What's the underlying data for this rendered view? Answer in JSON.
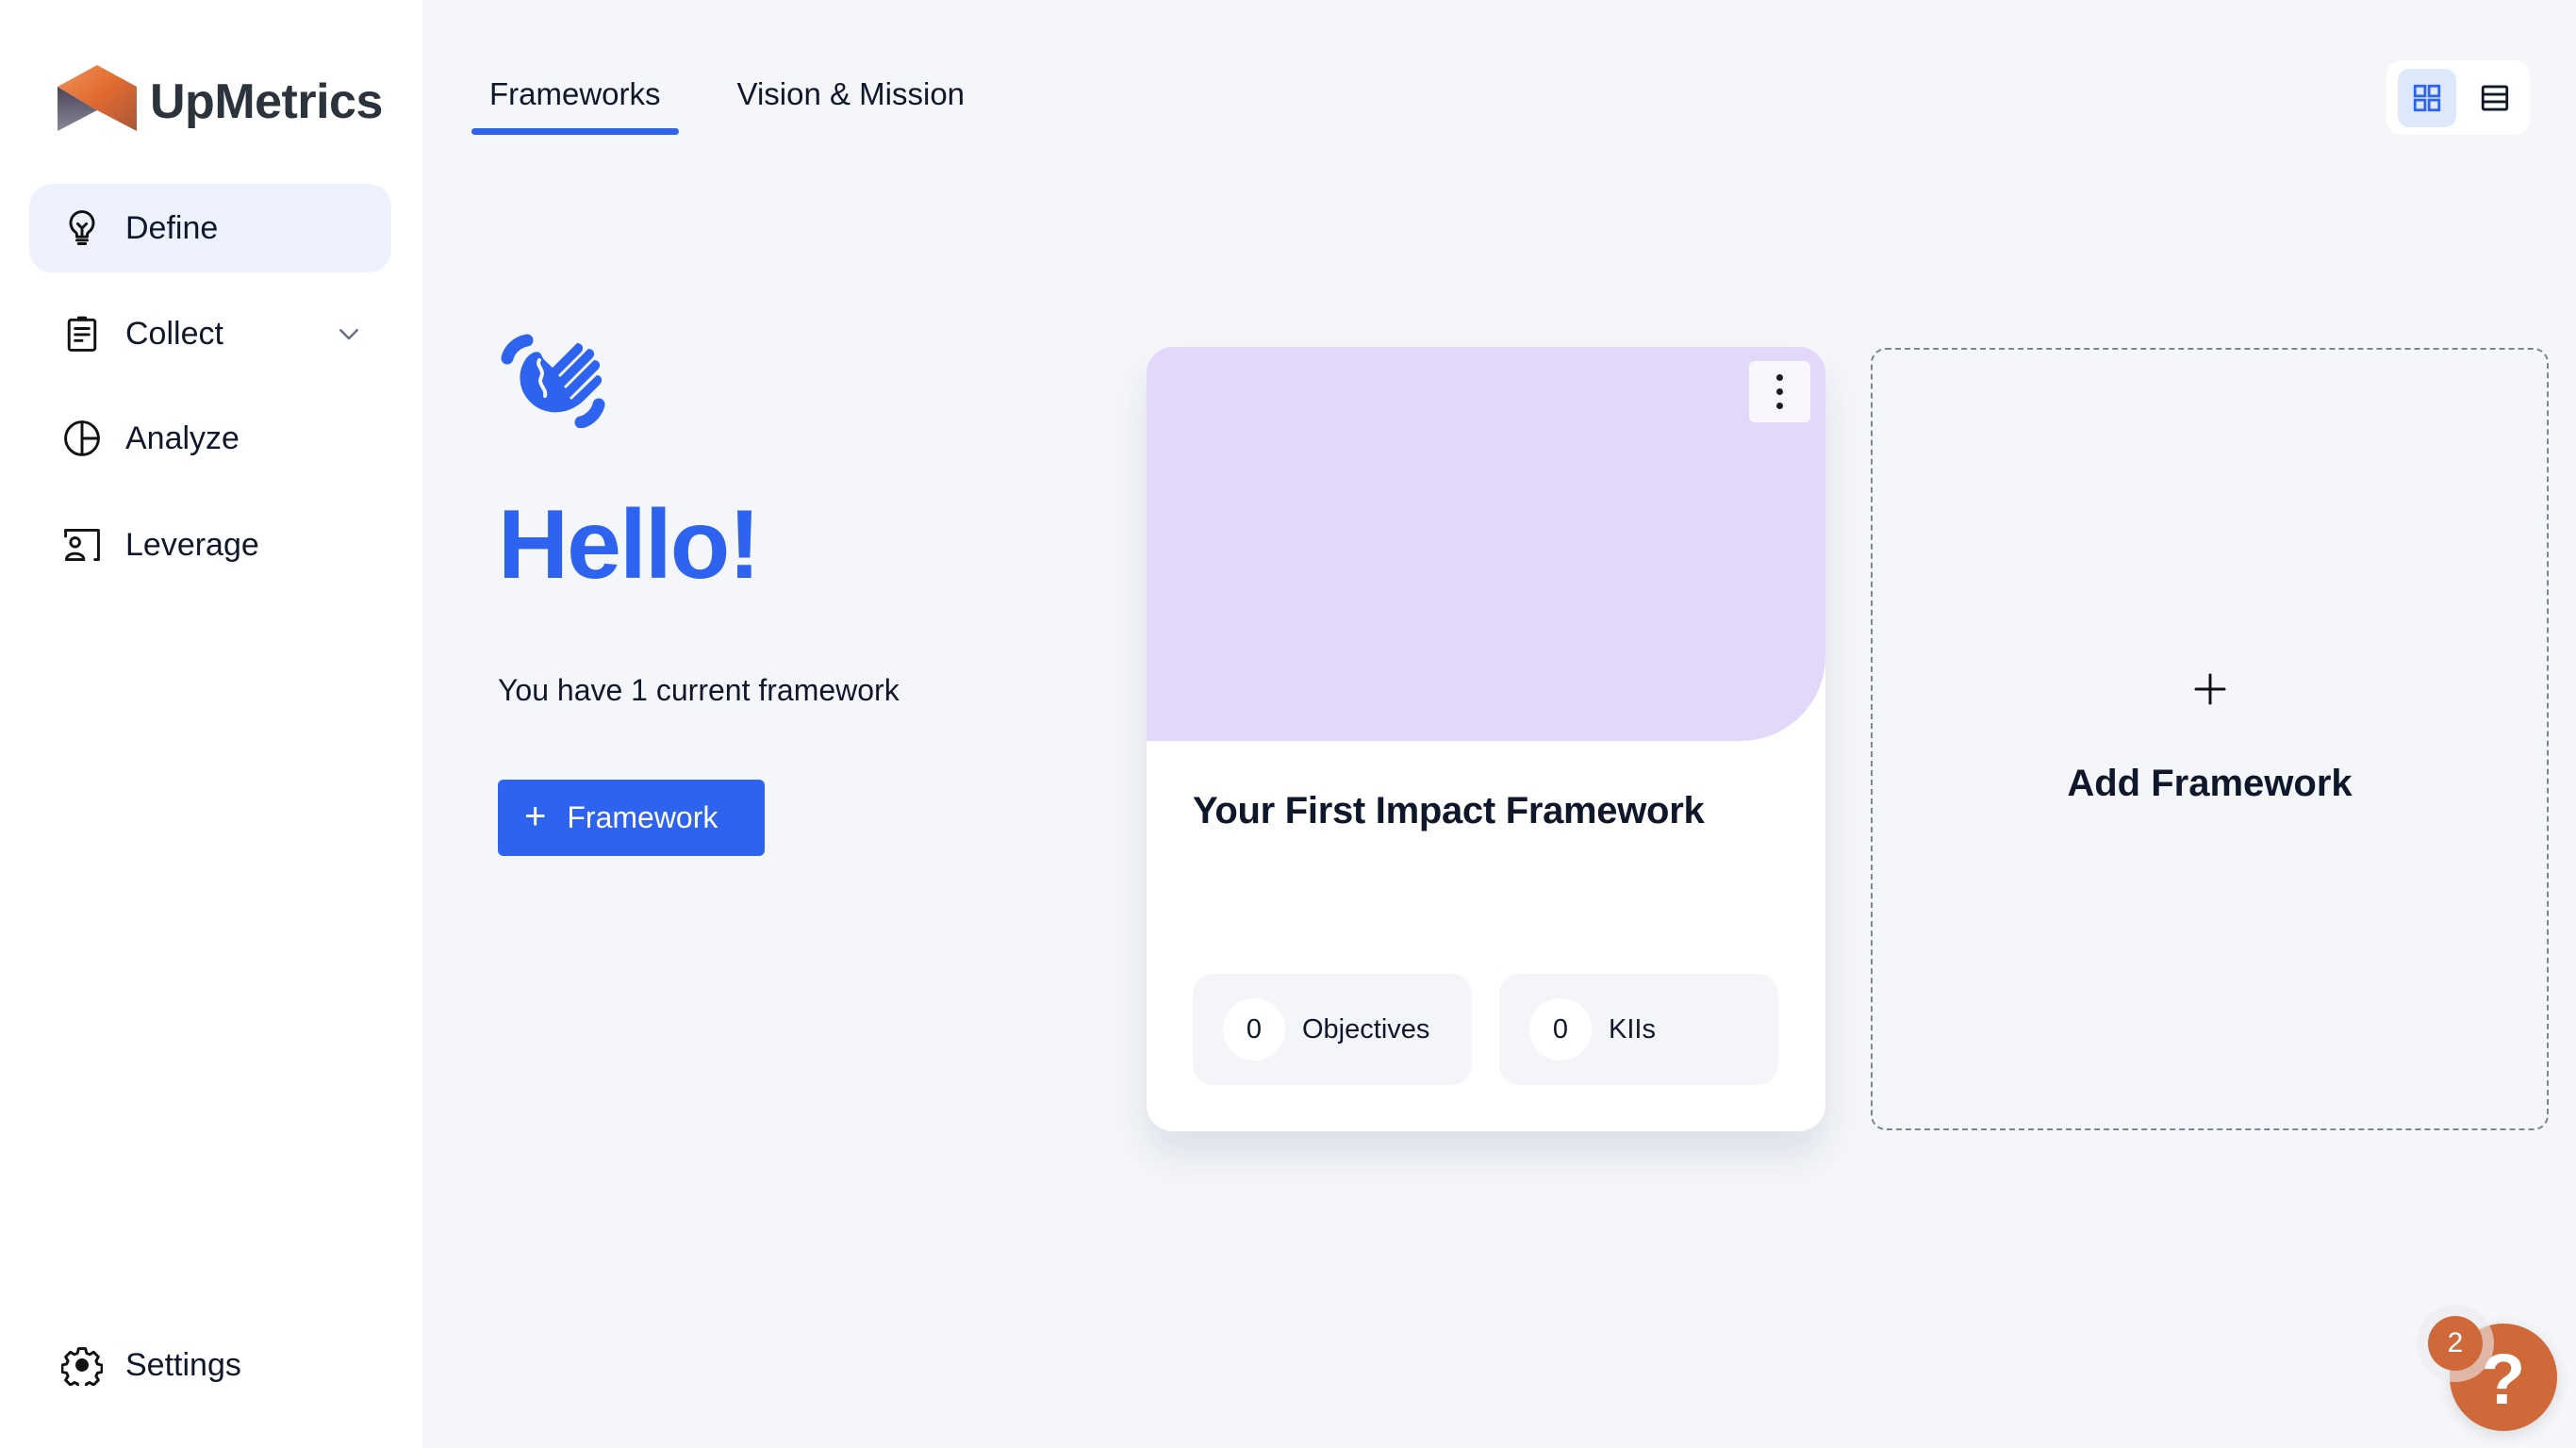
{
  "app": {
    "name": "UpMetrics"
  },
  "sidebar": {
    "items": [
      {
        "label": "Define",
        "icon": "lightbulb-icon",
        "active": true
      },
      {
        "label": "Collect",
        "icon": "clipboard-icon",
        "has_chevron": true
      },
      {
        "label": "Analyze",
        "icon": "pie-chart-icon"
      },
      {
        "label": "Leverage",
        "icon": "user-card-icon"
      }
    ],
    "settings": {
      "label": "Settings",
      "icon": "gear-icon"
    }
  },
  "tabs": [
    {
      "label": "Frameworks",
      "active": true
    },
    {
      "label": "Vision & Mission",
      "active": false
    }
  ],
  "view_toggle": {
    "options": [
      "grid-view",
      "list-view"
    ],
    "active": "grid-view"
  },
  "hero": {
    "greeting": "Hello!",
    "subtitle": "You have 1 current framework",
    "add_button_label": "Framework",
    "add_button_icon": "plus"
  },
  "frameworks": [
    {
      "title": "Your First Impact Framework",
      "header_color": "#e3d8fa",
      "stats": [
        {
          "value": "0",
          "label": "Objectives"
        },
        {
          "value": "0",
          "label": "KIIs"
        }
      ]
    }
  ],
  "add_card": {
    "label": "Add Framework",
    "icon": "+"
  },
  "help": {
    "icon": "?",
    "badge_count": "2"
  },
  "colors": {
    "accent": "#2e63f0",
    "brand_orange": "#d0693a",
    "card_header": "#e3d8fa",
    "background": "#f4f6fa"
  }
}
